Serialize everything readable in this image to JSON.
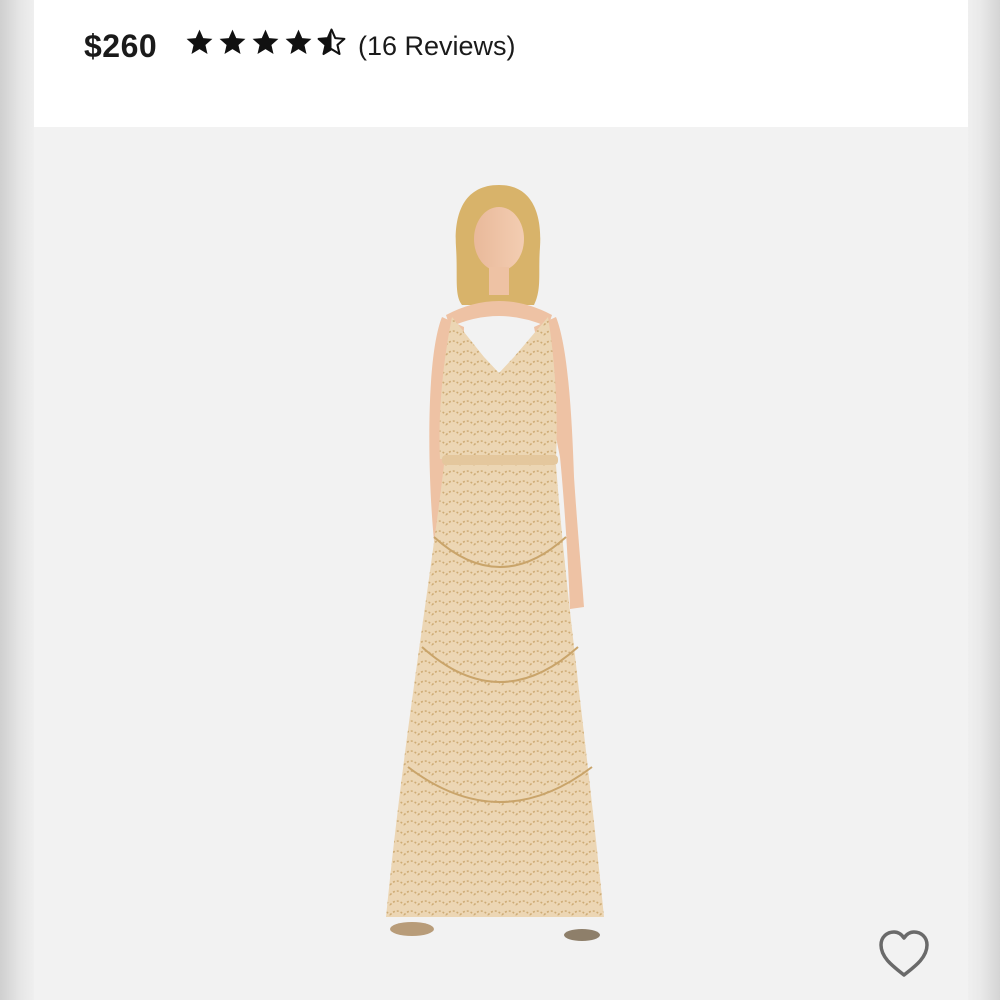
{
  "product": {
    "price": "$260",
    "rating": 4.5,
    "rating_max": 5,
    "reviews_label": "(16 Reviews)"
  },
  "icons": {
    "star": "star-icon",
    "wishlist": "heart-outline-icon"
  },
  "colors": {
    "text": "#1a1a1a",
    "image_background": "#f2f2f2",
    "dress": "#ecd6b4",
    "sequin": "#c9a46a"
  }
}
